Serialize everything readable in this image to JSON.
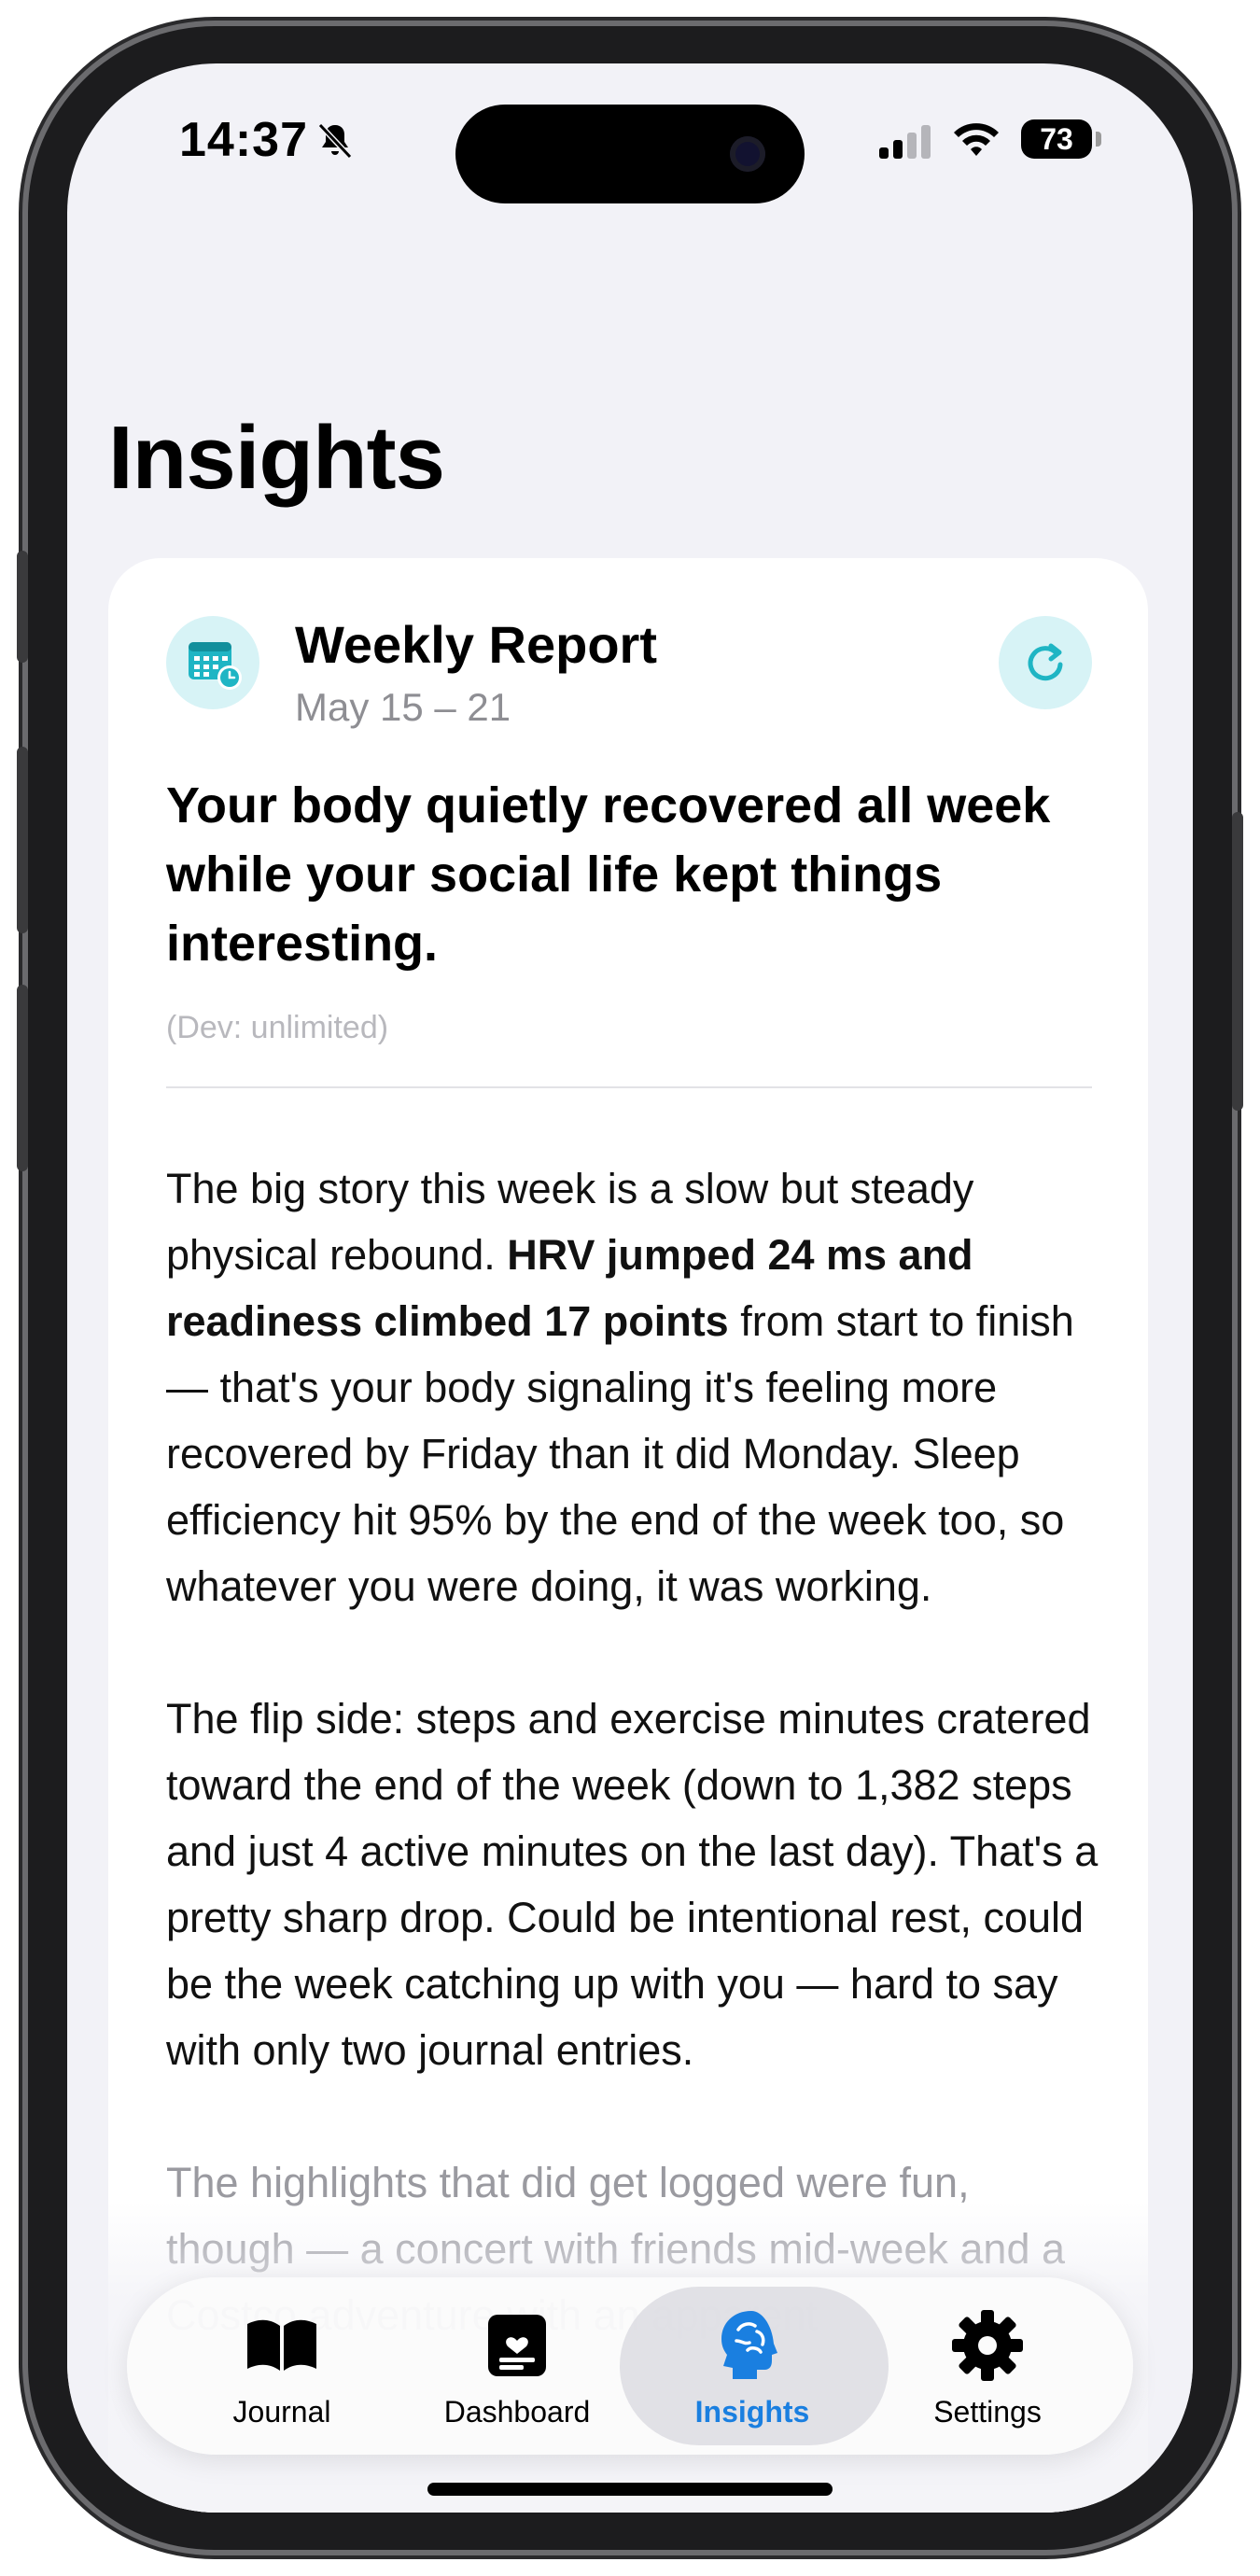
{
  "status_bar": {
    "time": "14:37",
    "battery": "73"
  },
  "page": {
    "title": "Insights"
  },
  "report": {
    "title": "Weekly Report",
    "date_range": "May 15 – 21",
    "headline": "Your body quietly recovered all week while your social life kept things interesting.",
    "dev_note": "(Dev: unlimited)",
    "paragraph1_a": "The big story this week is a slow but steady physical rebound. ",
    "paragraph1_bold": "HRV jumped 24 ms and readiness climbed 17 points",
    "paragraph1_b": " from start to finish — that's your body signaling it's feeling more recovered by Friday than it did Monday. Sleep efficiency hit 95% by the end of the week too, so whatever you were doing, it was working.",
    "paragraph2": "The flip side: steps and exercise minutes cratered toward the end of the week (down to 1,382 steps and just 4 active minutes on the last day). That's a pretty sharp drop. Could be intentional rest, could be the week catching up with you — hard to say with only two journal entries.",
    "paragraph3": "The highlights that did get logged were fun, though — a concert with friends mid-week and a Costco adventure with an apparent"
  },
  "tabs": [
    {
      "label": "Journal",
      "icon": "book-icon"
    },
    {
      "label": "Dashboard",
      "icon": "dashboard-icon"
    },
    {
      "label": "Insights",
      "icon": "brain-icon",
      "active": true
    },
    {
      "label": "Settings",
      "icon": "gear-icon"
    }
  ],
  "colors": {
    "accent": "#1a7fe0",
    "teal": "#1fb5c4",
    "teal_bg": "#d7f3f6",
    "background": "#f2f2f7"
  }
}
